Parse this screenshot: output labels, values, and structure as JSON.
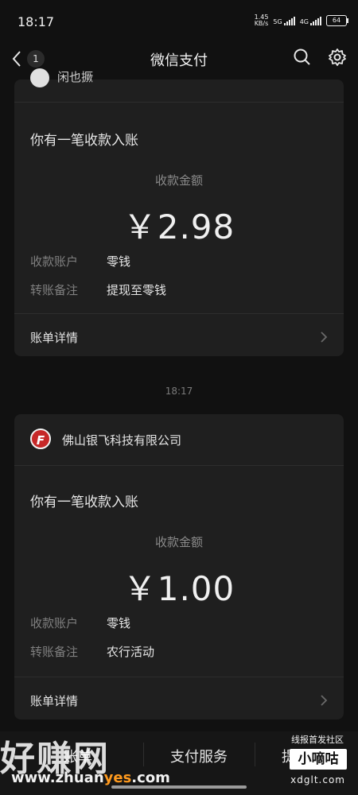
{
  "status_bar": {
    "time": "18:17",
    "speed": "1.45",
    "speed_unit": "KB/s",
    "net1": "5G",
    "net2": "4G",
    "battery": "64"
  },
  "nav": {
    "title": "微信支付",
    "back_count": "1",
    "icons": [
      "back-chevron-icon",
      "search-icon",
      "gear-icon"
    ]
  },
  "card1": {
    "partial_sender": "闲也撅",
    "title": "你有一笔收款入账",
    "amount_label": "收款金额",
    "amount": "￥2.98",
    "fields": [
      {
        "label": "收款账户",
        "value": "零钱"
      },
      {
        "label": "转账备注",
        "value": "提现至零钱"
      }
    ],
    "detail": "账单详情"
  },
  "timestamp": "18:17",
  "card2": {
    "logo_letter": "F",
    "sender": "佛山银飞科技有限公司",
    "title": "你有一笔收款入账",
    "amount_label": "收款金额",
    "amount": "￥1.00",
    "fields": [
      {
        "label": "收款账户",
        "value": "零钱"
      },
      {
        "label": "转账备注",
        "value": "农行活动"
      }
    ],
    "detail": "账单详情"
  },
  "bottom_bar": {
    "item1": "账单",
    "item2": "支付服务",
    "item3": "提"
  },
  "watermarks": {
    "left_text": "好赚网",
    "left_url_pre": "www.zhuan",
    "left_url_hl": "yes",
    "left_url_post": ".com",
    "right_top": "线报首发社区",
    "right_box": "小嘀咕",
    "right_url": "xdglt.com"
  },
  "colors": {
    "background": "#111111",
    "card": "#1f1f1f",
    "logo_red": "#c62828",
    "url_highlight": "#ff9a1e"
  }
}
